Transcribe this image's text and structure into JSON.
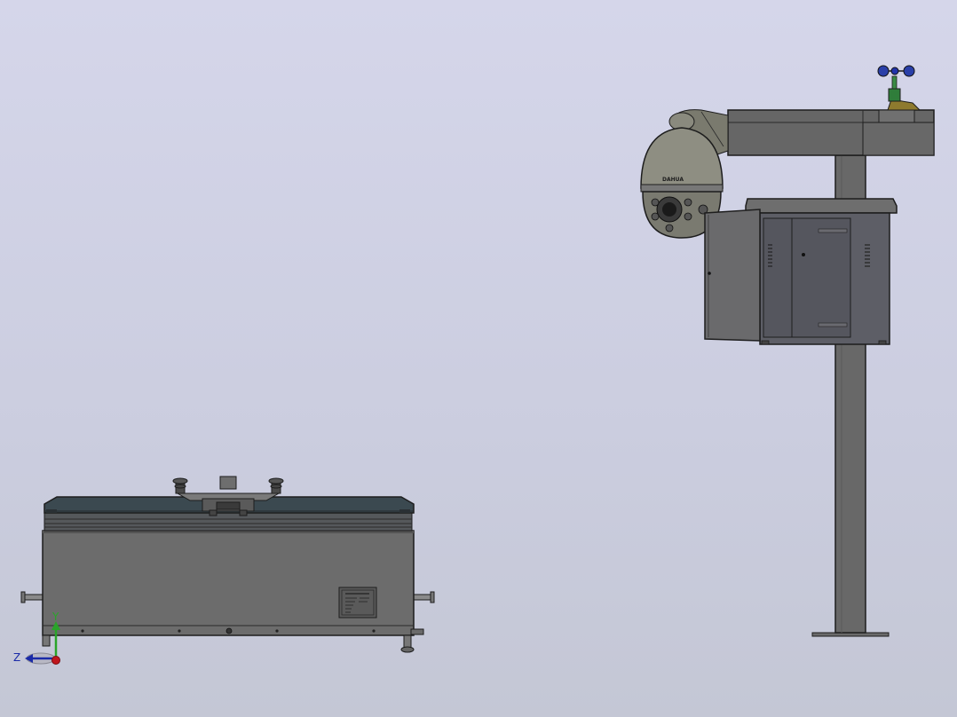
{
  "viewport": {
    "background": [
      "#d5d6ea",
      "#c4c7d5"
    ],
    "models": [
      {
        "name": "drone-docking-station",
        "parts": [
          "base-box",
          "dark-lid",
          "drone",
          "side-handles",
          "leveling-feet",
          "nameplate"
        ]
      },
      {
        "name": "monitoring-pole",
        "parts": [
          "pole",
          "cross-arm",
          "ptz-dome-camera",
          "equipment-cabinet",
          "anemometer"
        ]
      }
    ],
    "camera_brand_text": "DAHUA",
    "colors": {
      "steel": "#6b6b6b",
      "dark_panel": "#3d4a50",
      "cabinet": "#5f6066",
      "outline": "#1d1d1d"
    }
  },
  "triad": {
    "y_label": "Y",
    "z_label": "Z",
    "colors": {
      "x": "#c0161d",
      "y": "#2aa42a",
      "z": "#1a2aa8"
    }
  }
}
